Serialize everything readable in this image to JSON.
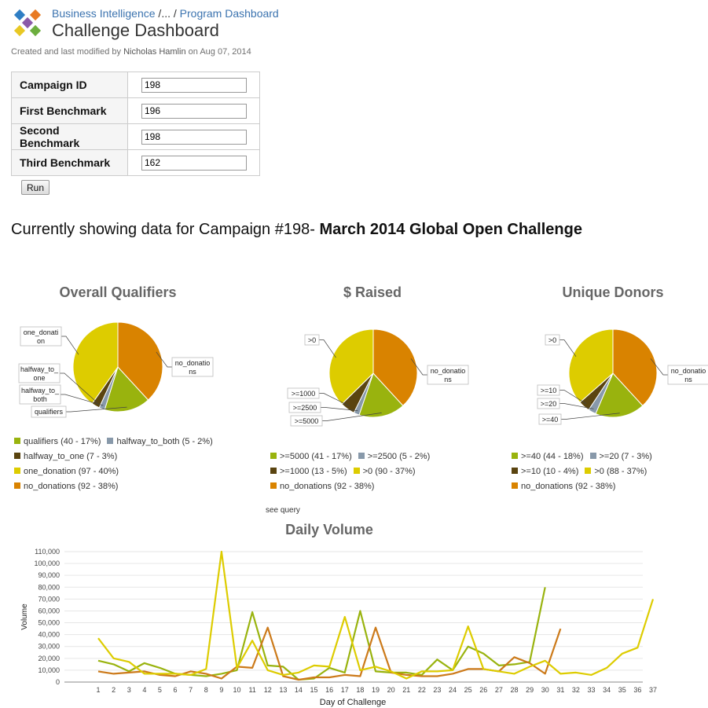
{
  "breadcrumb": {
    "parent": "Business Intelligence",
    "ellipsis": "...",
    "current": "Program Dashboard",
    "sep": "/"
  },
  "page": {
    "title": "Challenge Dashboard"
  },
  "meta": {
    "prefix": "Created and last modified by",
    "author": "Nicholas Hamlin",
    "date_text": "on Aug 07, 2014"
  },
  "form": {
    "rows": [
      {
        "label": "Campaign ID",
        "value": "198"
      },
      {
        "label": "First Benchmark",
        "value": "196"
      },
      {
        "label": "Second Benchmark",
        "value": "198"
      },
      {
        "label": "Third Benchmark",
        "value": "162"
      }
    ],
    "run_label": "Run"
  },
  "showing": {
    "prefix": "Currently showing data for Campaign #198-",
    "campaign_name": "March 2014 Global Open Challenge"
  },
  "colors": {
    "green": "#99b30e",
    "steel": "#8899aa",
    "brown": "#5a4410",
    "yellow": "#ddcc00",
    "orange": "#d98300",
    "line_orange": "#cc7a1a"
  },
  "see_query": "see query",
  "chart_data": [
    {
      "type": "pie",
      "title": "Overall Qualifiers",
      "slices": [
        {
          "label": "qualifiers",
          "value": 40,
          "pct": 17,
          "color": "#99b30e",
          "legend": "qualifiers (40 - 17%)"
        },
        {
          "label": "halfway_to_both",
          "value": 5,
          "pct": 2,
          "color": "#8899aa",
          "legend": "halfway_to_both (5 - 2%)"
        },
        {
          "label": "halfway_to_one",
          "value": 7,
          "pct": 3,
          "color": "#5a4410",
          "legend": "halfway_to_one (7 - 3%)"
        },
        {
          "label": "one_donation",
          "value": 97,
          "pct": 40,
          "color": "#ddcc00",
          "legend": "one_donation (97 - 40%)"
        },
        {
          "label": "no_donations",
          "value": 92,
          "pct": 38,
          "color": "#d98300",
          "legend": "no_donations (92 - 38%)"
        }
      ]
    },
    {
      "type": "pie",
      "title": "$ Raised",
      "slices": [
        {
          "label": ">=5000",
          "value": 41,
          "pct": 17,
          "color": "#99b30e",
          "legend": ">=5000 (41 - 17%)"
        },
        {
          "label": ">=2500",
          "value": 5,
          "pct": 2,
          "color": "#8899aa",
          "legend": ">=2500 (5 - 2%)"
        },
        {
          "label": ">=1000",
          "value": 13,
          "pct": 5,
          "color": "#5a4410",
          "legend": ">=1000 (13 - 5%)"
        },
        {
          "label": ">0",
          "value": 90,
          "pct": 37,
          "color": "#ddcc00",
          "legend": ">0 (90 - 37%)"
        },
        {
          "label": "no_donations",
          "value": 92,
          "pct": 38,
          "color": "#d98300",
          "legend": "no_donations (92 - 38%)"
        }
      ]
    },
    {
      "type": "pie",
      "title": "Unique Donors",
      "slices": [
        {
          "label": ">=40",
          "value": 44,
          "pct": 18,
          "color": "#99b30e",
          "legend": ">=40 (44 - 18%)"
        },
        {
          "label": ">=20",
          "value": 7,
          "pct": 3,
          "color": "#8899aa",
          "legend": ">=20 (7 - 3%)"
        },
        {
          "label": ">=10",
          "value": 10,
          "pct": 4,
          "color": "#5a4410",
          "legend": ">=10 (10 - 4%)"
        },
        {
          "label": ">0",
          "value": 88,
          "pct": 37,
          "color": "#ddcc00",
          "legend": ">0 (88 - 37%)"
        },
        {
          "label": "no_donations",
          "value": 92,
          "pct": 38,
          "color": "#d98300",
          "legend": "no_donations (92 - 38%)"
        }
      ]
    },
    {
      "type": "line",
      "title": "Daily Volume",
      "xlabel": "Day of Challenge",
      "ylabel": "Volume",
      "ylim": [
        0,
        110000
      ],
      "yticks": [
        0,
        10000,
        20000,
        30000,
        40000,
        50000,
        60000,
        70000,
        80000,
        90000,
        100000,
        110000
      ],
      "ytick_labels": [
        "0",
        "10,000",
        "20,000",
        "30,000",
        "40,000",
        "50,000",
        "60,000",
        "70,000",
        "80,000",
        "90,000",
        "100,000",
        "110,000"
      ],
      "categories": [
        "1",
        "2",
        "3",
        "4",
        "5",
        "6",
        "7",
        "8",
        "9",
        "10",
        "11",
        "12",
        "13",
        "14",
        "15",
        "16",
        "17",
        "18",
        "19",
        "20",
        "21",
        "22",
        "23",
        "24",
        "25",
        "26",
        "27",
        "28",
        "29",
        "30",
        "31",
        "32",
        "33",
        "34",
        "35",
        "36",
        "37"
      ],
      "grid": true,
      "series": [
        {
          "color": "#99b30e",
          "values": [
            18000,
            15000,
            9000,
            16000,
            12000,
            7000,
            6000,
            5000,
            7000,
            10000,
            59000,
            14000,
            13000,
            2000,
            3000,
            12000,
            8000,
            60000,
            9000,
            8000,
            8000,
            6000,
            19000,
            10000,
            30000,
            24000,
            14000,
            15000,
            17000,
            80000
          ]
        },
        {
          "color": "#cc7a1a",
          "values": [
            9000,
            7000,
            8000,
            9000,
            6000,
            5000,
            9000,
            7000,
            3000,
            13000,
            12000,
            46000,
            5000,
            2000,
            4000,
            4000,
            6000,
            5000,
            46000,
            8000,
            6000,
            5000,
            5000,
            7000,
            11000,
            11000,
            9000,
            21000,
            16000,
            7000,
            45000
          ]
        },
        {
          "color": "#ddcc00",
          "values": [
            37000,
            20000,
            17000,
            7000,
            7000,
            7000,
            6000,
            11000,
            110000,
            12000,
            35000,
            10000,
            6000,
            8000,
            14000,
            13000,
            55000,
            10000,
            13000,
            9000,
            3000,
            9000,
            9000,
            10000,
            47000,
            11000,
            9000,
            7000,
            13000,
            18000,
            7000,
            8000,
            6000,
            12000,
            24000,
            29000,
            70000
          ]
        }
      ]
    }
  ]
}
